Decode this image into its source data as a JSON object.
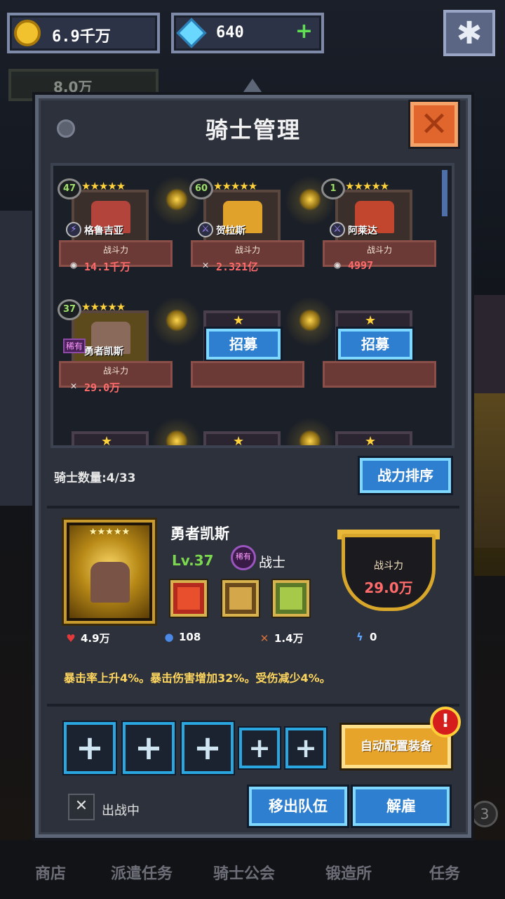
{
  "currency": {
    "gold": "6.9千万",
    "gems": "640",
    "secondary": "8.0万"
  },
  "panel": {
    "title": "骑士管理"
  },
  "knights": [
    {
      "level": "47",
      "stars": "★★★★★",
      "name": "格鲁吉亚",
      "power_label": "战斗力",
      "power": "14.1千万",
      "power_icon": "cake-icon",
      "color": "#b2443c"
    },
    {
      "level": "60",
      "stars": "★★★★★",
      "name": "贺拉斯",
      "power_label": "战斗力",
      "power": "2.321亿",
      "power_icon": "crossed-swords-icon",
      "color": "#e0a22a"
    },
    {
      "level": "1",
      "stars": "★★★★★",
      "name": "阿莱达",
      "power_label": "战斗力",
      "power": "4997",
      "power_icon": "cake-icon",
      "color": "#c2452e"
    },
    {
      "level": "37",
      "stars": "★★★★★",
      "name": "勇者凯斯",
      "rare": "稀有",
      "power_label": "战斗力",
      "power": "29.0万",
      "power_icon": "crossed-swords-icon",
      "color": "#8a6a5a"
    }
  ],
  "recruit_label": "招募",
  "empty_star": "★",
  "knight_count": "骑士数量:4/33",
  "sort_label": "战力排序",
  "detail": {
    "stars": "★★★★★",
    "name": "勇者凯斯",
    "level": "Lv.37",
    "rare": "稀有",
    "class": "战士",
    "power_label": "战斗力",
    "power": "29.0万",
    "hp": "4.9万",
    "mp": "108",
    "attack": "1.4万",
    "speed": "0",
    "description": "暴击率上升4%。暴击伤害增加32%。受伤减少4%。"
  },
  "auto_equip_label": "自动配置装备",
  "alert_mark": "!",
  "deploy_status": "出战中",
  "remove_label": "移出队伍",
  "fire_label": "解雇",
  "nav": [
    "商店",
    "派遣任务",
    "骑士公会",
    "锻造所",
    "任务"
  ],
  "nav_badge": "3",
  "colors": {
    "accent_blue": "#2f7fd0",
    "gold": "#d8a62a",
    "close_orange": "#e0662e"
  }
}
